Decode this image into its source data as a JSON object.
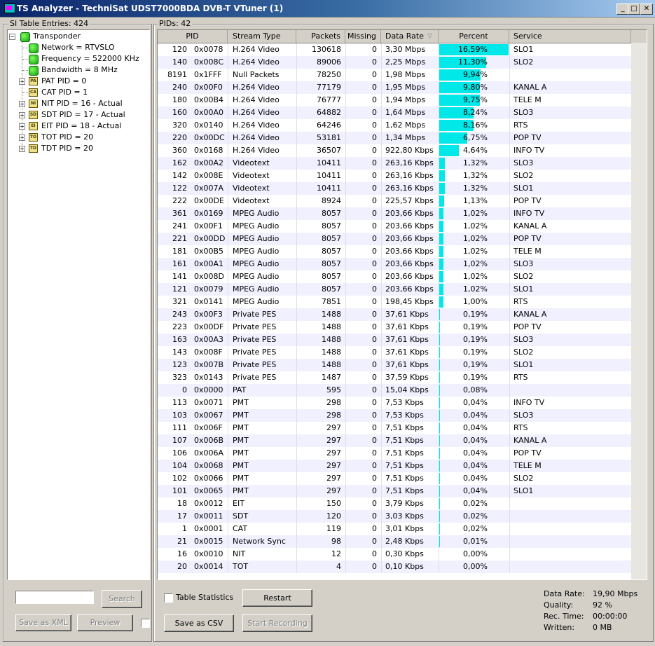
{
  "window": {
    "title": "TS Analyzer - TechniSat UDST7000BDA DVB-T VTuner (1)"
  },
  "si_panel": {
    "header": "SI Table Entries: 424",
    "tree": [
      {
        "label": "Transponder",
        "icon": "green-dot-icon",
        "expander": "−"
      },
      {
        "label": "Network = RTVSLO",
        "icon": "green-dot-icon",
        "expander": ""
      },
      {
        "label": "Frequency = 522000 KHz",
        "icon": "green-dot-icon",
        "expander": ""
      },
      {
        "label": "Bandwidth = 8 MHz",
        "icon": "green-dot-icon",
        "expander": ""
      },
      {
        "label": "PAT PID = 0",
        "icon": "table-icon",
        "badge": "PA",
        "expander": "+"
      },
      {
        "label": "CAT PID = 1",
        "icon": "table-icon",
        "badge": "CA",
        "expander": ""
      },
      {
        "label": "NIT PID = 16 - Actual",
        "icon": "table-icon",
        "badge": "NI",
        "expander": "+"
      },
      {
        "label": "SDT PID = 17 - Actual",
        "icon": "table-icon",
        "badge": "SD",
        "expander": "+"
      },
      {
        "label": "EIT PID = 18 - Actual",
        "icon": "table-icon",
        "badge": "EI",
        "expander": "+"
      },
      {
        "label": "TOT PID = 20",
        "icon": "table-icon",
        "badge": "TO",
        "expander": "+"
      },
      {
        "label": "TDT PID = 20",
        "icon": "table-icon",
        "badge": "TD",
        "expander": "+"
      }
    ],
    "search_input_value": "",
    "search_button": "Search",
    "save_xml_button": "Save as XML",
    "preview_button": "Preview"
  },
  "pid_panel": {
    "header": "PIDs: 42",
    "columns": [
      "PID",
      "Stream Type",
      "Packets",
      "Missing",
      "Data Rate",
      "Percent",
      "Service"
    ],
    "sort_indicator": "▽",
    "rows": [
      {
        "pid": "120",
        "hex": "0x0078",
        "type": "H.264 Video",
        "packets": "130618",
        "missing": "0",
        "rate": "3,30 Mbps",
        "percent": "16,59%",
        "pct": 16.59,
        "service": "SLO1"
      },
      {
        "pid": "140",
        "hex": "0x008C",
        "type": "H.264 Video",
        "packets": "89006",
        "missing": "0",
        "rate": "2,25 Mbps",
        "percent": "11,30%",
        "pct": 11.3,
        "service": "SLO2"
      },
      {
        "pid": "8191",
        "hex": "0x1FFF",
        "type": "Null Packets",
        "packets": "78250",
        "missing": "0",
        "rate": "1,98 Mbps",
        "percent": "9,94%",
        "pct": 9.94,
        "service": ""
      },
      {
        "pid": "240",
        "hex": "0x00F0",
        "type": "H.264 Video",
        "packets": "77179",
        "missing": "0",
        "rate": "1,95 Mbps",
        "percent": "9,80%",
        "pct": 9.8,
        "service": "KANAL A"
      },
      {
        "pid": "180",
        "hex": "0x00B4",
        "type": "H.264 Video",
        "packets": "76777",
        "missing": "0",
        "rate": "1,94 Mbps",
        "percent": "9,75%",
        "pct": 9.75,
        "service": "TELE M"
      },
      {
        "pid": "160",
        "hex": "0x00A0",
        "type": "H.264 Video",
        "packets": "64882",
        "missing": "0",
        "rate": "1,64 Mbps",
        "percent": "8,24%",
        "pct": 8.24,
        "service": "SLO3"
      },
      {
        "pid": "320",
        "hex": "0x0140",
        "type": "H.264 Video",
        "packets": "64246",
        "missing": "0",
        "rate": "1,62 Mbps",
        "percent": "8,16%",
        "pct": 8.16,
        "service": "RTS"
      },
      {
        "pid": "220",
        "hex": "0x00DC",
        "type": "H.264 Video",
        "packets": "53181",
        "missing": "0",
        "rate": "1,34 Mbps",
        "percent": "6,75%",
        "pct": 6.75,
        "service": "POP TV"
      },
      {
        "pid": "360",
        "hex": "0x0168",
        "type": "H.264 Video",
        "packets": "36507",
        "missing": "0",
        "rate": "922,80 Kbps",
        "percent": "4,64%",
        "pct": 4.64,
        "service": "INFO TV"
      },
      {
        "pid": "162",
        "hex": "0x00A2",
        "type": "Videotext",
        "packets": "10411",
        "missing": "0",
        "rate": "263,16 Kbps",
        "percent": "1,32%",
        "pct": 1.32,
        "service": "SLO3"
      },
      {
        "pid": "142",
        "hex": "0x008E",
        "type": "Videotext",
        "packets": "10411",
        "missing": "0",
        "rate": "263,16 Kbps",
        "percent": "1,32%",
        "pct": 1.32,
        "service": "SLO2"
      },
      {
        "pid": "122",
        "hex": "0x007A",
        "type": "Videotext",
        "packets": "10411",
        "missing": "0",
        "rate": "263,16 Kbps",
        "percent": "1,32%",
        "pct": 1.32,
        "service": "SLO1"
      },
      {
        "pid": "222",
        "hex": "0x00DE",
        "type": "Videotext",
        "packets": "8924",
        "missing": "0",
        "rate": "225,57 Kbps",
        "percent": "1,13%",
        "pct": 1.13,
        "service": "POP TV"
      },
      {
        "pid": "361",
        "hex": "0x0169",
        "type": "MPEG Audio",
        "packets": "8057",
        "missing": "0",
        "rate": "203,66 Kbps",
        "percent": "1,02%",
        "pct": 1.02,
        "service": "INFO TV"
      },
      {
        "pid": "241",
        "hex": "0x00F1",
        "type": "MPEG Audio",
        "packets": "8057",
        "missing": "0",
        "rate": "203,66 Kbps",
        "percent": "1,02%",
        "pct": 1.02,
        "service": "KANAL A"
      },
      {
        "pid": "221",
        "hex": "0x00DD",
        "type": "MPEG Audio",
        "packets": "8057",
        "missing": "0",
        "rate": "203,66 Kbps",
        "percent": "1,02%",
        "pct": 1.02,
        "service": "POP TV"
      },
      {
        "pid": "181",
        "hex": "0x00B5",
        "type": "MPEG Audio",
        "packets": "8057",
        "missing": "0",
        "rate": "203,66 Kbps",
        "percent": "1,02%",
        "pct": 1.02,
        "service": "TELE M"
      },
      {
        "pid": "161",
        "hex": "0x00A1",
        "type": "MPEG Audio",
        "packets": "8057",
        "missing": "0",
        "rate": "203,66 Kbps",
        "percent": "1,02%",
        "pct": 1.02,
        "service": "SLO3"
      },
      {
        "pid": "141",
        "hex": "0x008D",
        "type": "MPEG Audio",
        "packets": "8057",
        "missing": "0",
        "rate": "203,66 Kbps",
        "percent": "1,02%",
        "pct": 1.02,
        "service": "SLO2"
      },
      {
        "pid": "121",
        "hex": "0x0079",
        "type": "MPEG Audio",
        "packets": "8057",
        "missing": "0",
        "rate": "203,66 Kbps",
        "percent": "1,02%",
        "pct": 1.02,
        "service": "SLO1"
      },
      {
        "pid": "321",
        "hex": "0x0141",
        "type": "MPEG Audio",
        "packets": "7851",
        "missing": "0",
        "rate": "198,45 Kbps",
        "percent": "1,00%",
        "pct": 1.0,
        "service": "RTS"
      },
      {
        "pid": "243",
        "hex": "0x00F3",
        "type": "Private PES",
        "packets": "1488",
        "missing": "0",
        "rate": "37,61 Kbps",
        "percent": "0,19%",
        "pct": 0.19,
        "service": "KANAL A"
      },
      {
        "pid": "223",
        "hex": "0x00DF",
        "type": "Private PES",
        "packets": "1488",
        "missing": "0",
        "rate": "37,61 Kbps",
        "percent": "0,19%",
        "pct": 0.19,
        "service": "POP TV"
      },
      {
        "pid": "163",
        "hex": "0x00A3",
        "type": "Private PES",
        "packets": "1488",
        "missing": "0",
        "rate": "37,61 Kbps",
        "percent": "0,19%",
        "pct": 0.19,
        "service": "SLO3"
      },
      {
        "pid": "143",
        "hex": "0x008F",
        "type": "Private PES",
        "packets": "1488",
        "missing": "0",
        "rate": "37,61 Kbps",
        "percent": "0,19%",
        "pct": 0.19,
        "service": "SLO2"
      },
      {
        "pid": "123",
        "hex": "0x007B",
        "type": "Private PES",
        "packets": "1488",
        "missing": "0",
        "rate": "37,61 Kbps",
        "percent": "0,19%",
        "pct": 0.19,
        "service": "SLO1"
      },
      {
        "pid": "323",
        "hex": "0x0143",
        "type": "Private PES",
        "packets": "1487",
        "missing": "0",
        "rate": "37,59 Kbps",
        "percent": "0,19%",
        "pct": 0.19,
        "service": "RTS"
      },
      {
        "pid": "0",
        "hex": "0x0000",
        "type": "PAT",
        "packets": "595",
        "missing": "0",
        "rate": "15,04 Kbps",
        "percent": "0,08%",
        "pct": 0.08,
        "service": ""
      },
      {
        "pid": "113",
        "hex": "0x0071",
        "type": "PMT",
        "packets": "298",
        "missing": "0",
        "rate": "7,53 Kbps",
        "percent": "0,04%",
        "pct": 0.04,
        "service": "INFO TV"
      },
      {
        "pid": "103",
        "hex": "0x0067",
        "type": "PMT",
        "packets": "298",
        "missing": "0",
        "rate": "7,53 Kbps",
        "percent": "0,04%",
        "pct": 0.04,
        "service": "SLO3"
      },
      {
        "pid": "111",
        "hex": "0x006F",
        "type": "PMT",
        "packets": "297",
        "missing": "0",
        "rate": "7,51 Kbps",
        "percent": "0,04%",
        "pct": 0.04,
        "service": "RTS"
      },
      {
        "pid": "107",
        "hex": "0x006B",
        "type": "PMT",
        "packets": "297",
        "missing": "0",
        "rate": "7,51 Kbps",
        "percent": "0,04%",
        "pct": 0.04,
        "service": "KANAL A"
      },
      {
        "pid": "106",
        "hex": "0x006A",
        "type": "PMT",
        "packets": "297",
        "missing": "0",
        "rate": "7,51 Kbps",
        "percent": "0,04%",
        "pct": 0.04,
        "service": "POP TV"
      },
      {
        "pid": "104",
        "hex": "0x0068",
        "type": "PMT",
        "packets": "297",
        "missing": "0",
        "rate": "7,51 Kbps",
        "percent": "0,04%",
        "pct": 0.04,
        "service": "TELE M"
      },
      {
        "pid": "102",
        "hex": "0x0066",
        "type": "PMT",
        "packets": "297",
        "missing": "0",
        "rate": "7,51 Kbps",
        "percent": "0,04%",
        "pct": 0.04,
        "service": "SLO2"
      },
      {
        "pid": "101",
        "hex": "0x0065",
        "type": "PMT",
        "packets": "297",
        "missing": "0",
        "rate": "7,51 Kbps",
        "percent": "0,04%",
        "pct": 0.04,
        "service": "SLO1"
      },
      {
        "pid": "18",
        "hex": "0x0012",
        "type": "EIT",
        "packets": "150",
        "missing": "0",
        "rate": "3,79 Kbps",
        "percent": "0,02%",
        "pct": 0.02,
        "service": ""
      },
      {
        "pid": "17",
        "hex": "0x0011",
        "type": "SDT",
        "packets": "120",
        "missing": "0",
        "rate": "3,03 Kbps",
        "percent": "0,02%",
        "pct": 0.02,
        "service": ""
      },
      {
        "pid": "1",
        "hex": "0x0001",
        "type": "CAT",
        "packets": "119",
        "missing": "0",
        "rate": "3,01 Kbps",
        "percent": "0,02%",
        "pct": 0.02,
        "service": ""
      },
      {
        "pid": "21",
        "hex": "0x0015",
        "type": "Network Sync",
        "packets": "98",
        "missing": "0",
        "rate": "2,48 Kbps",
        "percent": "0,01%",
        "pct": 0.01,
        "service": ""
      },
      {
        "pid": "16",
        "hex": "0x0010",
        "type": "NIT",
        "packets": "12",
        "missing": "0",
        "rate": "0,30 Kbps",
        "percent": "0,00%",
        "pct": 0.0,
        "service": ""
      },
      {
        "pid": "20",
        "hex": "0x0014",
        "type": "TOT",
        "packets": "4",
        "missing": "0",
        "rate": "0,10 Kbps",
        "percent": "0,00%",
        "pct": 0.0,
        "service": ""
      }
    ],
    "table_statistics_label": "Table Statistics",
    "restart_button": "Restart",
    "save_csv_button": "Save as CSV",
    "start_recording_button": "Start Recording",
    "stats": [
      {
        "label": "Data Rate:",
        "value": "19,90 Mbps"
      },
      {
        "label": "Quality:",
        "value": "92 %"
      },
      {
        "label": "Rec. Time:",
        "value": "00:00:00"
      },
      {
        "label": "Written:",
        "value": "0 MB"
      }
    ]
  },
  "colors": {
    "bar": "#00e8e8",
    "alt_row": "#f0f0ff"
  }
}
